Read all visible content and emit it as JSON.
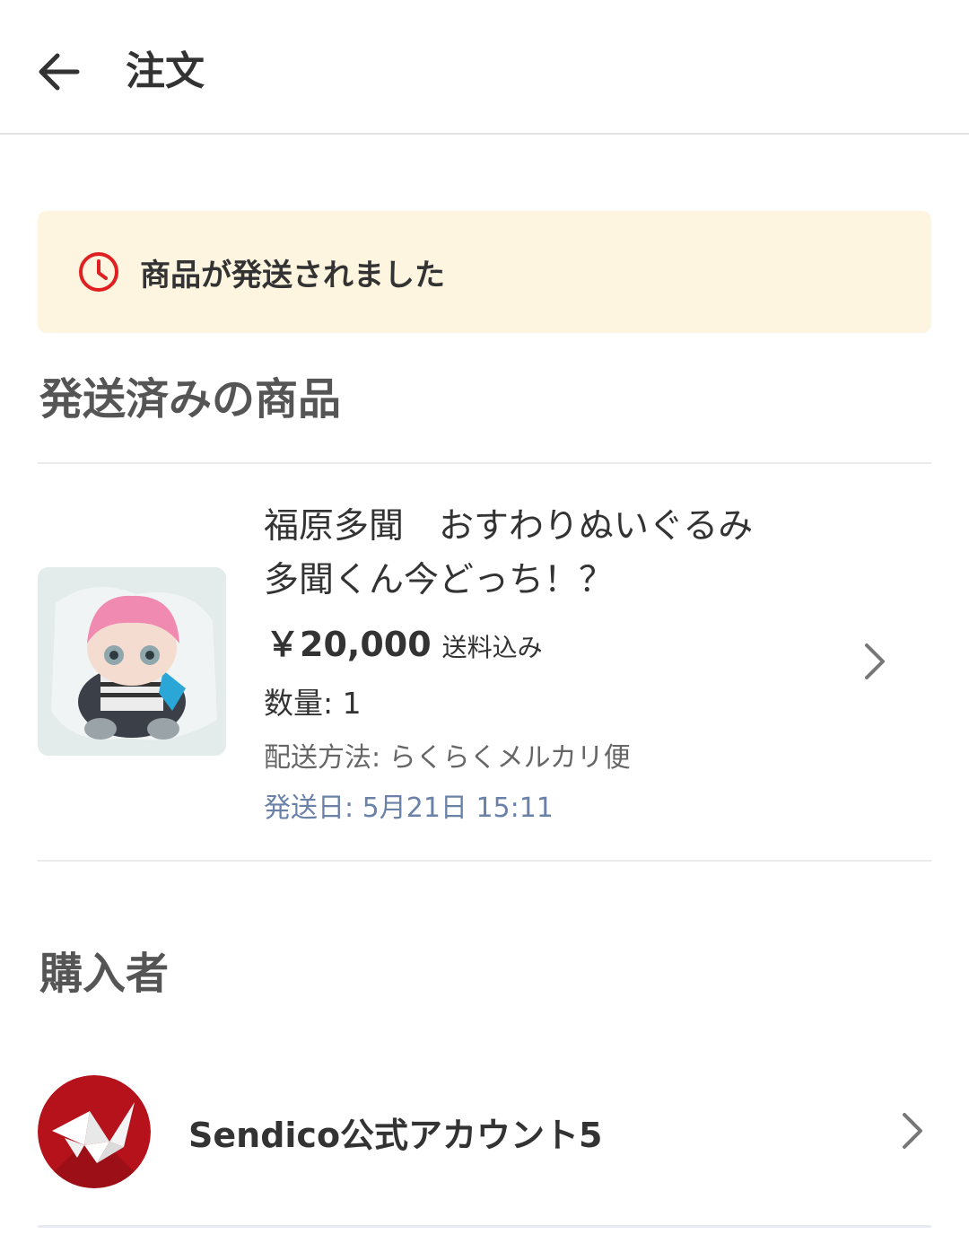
{
  "header": {
    "title": "注文",
    "back_icon": "arrow-left-icon"
  },
  "status": {
    "icon": "clock-icon",
    "text": "商品が発送されました",
    "icon_color": "#e02020",
    "background": "#fdf5df"
  },
  "shipped_section": {
    "title": "発送済みの商品"
  },
  "product": {
    "name_line1": "福原多聞　おすわりぬいぐるみ",
    "name_line2": "多聞くん今どっち！？",
    "price": "￥20,000",
    "price_note": "送料込み",
    "quantity": "数量: 1",
    "shipping_method": "配送方法: らくらくメルカリ便",
    "ship_date": "発送日: 5月21日 15:11"
  },
  "buyer_section": {
    "title": "購入者",
    "name": "Sendico公式アカウント5",
    "avatar_icon": "paper-crane-icon",
    "avatar_color": "#b5121b"
  }
}
